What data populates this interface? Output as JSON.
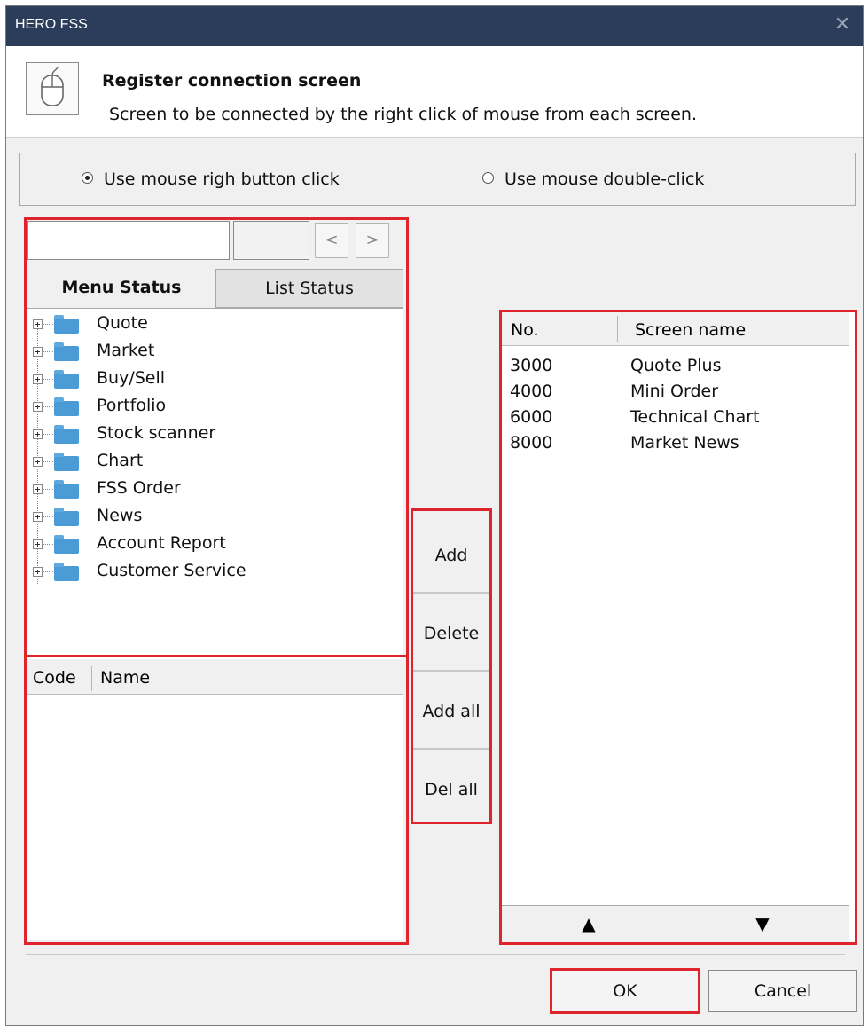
{
  "window": {
    "title": "HERO FSS",
    "close_glyph": "✕"
  },
  "header": {
    "icon": "mouse-icon",
    "title": "Register connection screen",
    "subtitle": "Screen to be connected by the right click of mouse from each screen."
  },
  "options": {
    "right_click_label": "Use mouse righ button click",
    "right_click_selected": true,
    "double_click_label": "Use mouse double-click",
    "double_click_selected": false
  },
  "left": {
    "search_value": "",
    "prev_label": "<",
    "next_label": ">",
    "tabs": [
      {
        "label": "Menu Status",
        "active": true
      },
      {
        "label": "List Status",
        "active": false
      }
    ],
    "tree": [
      {
        "label": "Quote"
      },
      {
        "label": "Market"
      },
      {
        "label": "Buy/Sell"
      },
      {
        "label": "Portfolio"
      },
      {
        "label": "Stock scanner"
      },
      {
        "label": "Chart"
      },
      {
        "label": "FSS Order"
      },
      {
        "label": "News"
      },
      {
        "label": "Account Report"
      },
      {
        "label": "Customer Service"
      }
    ],
    "list_headers": {
      "code": "Code",
      "name": "Name"
    }
  },
  "actions": {
    "add": "Add",
    "delete": "Delete",
    "add_all": "Add all",
    "del_all": "Del all"
  },
  "right": {
    "headers": {
      "no": "No.",
      "name": "Screen name"
    },
    "rows": [
      {
        "no": "3000",
        "name": "Quote Plus"
      },
      {
        "no": "4000",
        "name": "Mini Order"
      },
      {
        "no": "6000",
        "name": "Technical Chart"
      },
      {
        "no": "8000",
        "name": "Market News"
      }
    ],
    "up_glyph": "▲",
    "down_glyph": "▼"
  },
  "footer": {
    "ok": "OK",
    "cancel": "Cancel"
  },
  "colors": {
    "highlight": "#e0242c",
    "titlebar": "#2b3d5a",
    "folder": "#4a9bd6"
  }
}
